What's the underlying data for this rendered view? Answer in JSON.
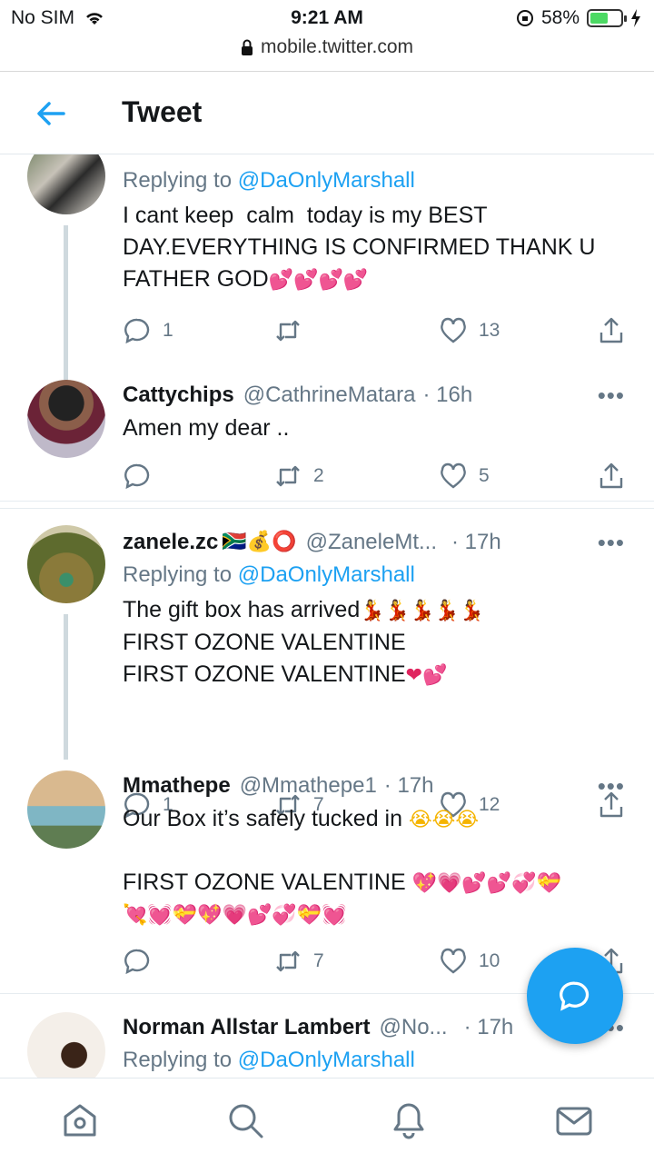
{
  "status_bar": {
    "carrier": "No SIM",
    "time": "9:21 AM",
    "battery": "58%",
    "battery_level": 0.58
  },
  "browser": {
    "url": "mobile.twitter.com"
  },
  "header": {
    "title": "Tweet"
  },
  "tweets": [
    {
      "name": "",
      "handle": "",
      "time": "",
      "replying_label": "Replying to",
      "replying_to": "@DaOnlyMarshall",
      "text": "I cant keep  calm  today is my BEST DAY.EVERYTHING IS CONFIRMED THANK U FATHER GOD",
      "emoji": "💕💕💕💕",
      "replies": "1",
      "retweets": "",
      "likes": "13"
    },
    {
      "name": "Cattychips",
      "handle": "@CathrineMatara",
      "time": "· 16h",
      "text": "Amen my dear ..",
      "replies": "",
      "retweets": "2",
      "likes": "5"
    },
    {
      "name": "zanele.zc",
      "name_emoji": "🇿🇦💰⭕",
      "handle": "@ZaneleMt...",
      "time": "· 17h",
      "replying_label": "Replying to",
      "replying_to": "@DaOnlyMarshall",
      "text_line1": "The gift box has arrived",
      "line1_emoji": "💃💃💃💃💃",
      "text_line2": "FIRST OZONE VALENTINE",
      "text_line3": "FIRST OZONE VALENTINE",
      "line3_emoji": "❤💕",
      "replies": "1",
      "retweets": "7",
      "likes": "12"
    },
    {
      "name": "Mmathepe",
      "handle": "@Mmathepe1",
      "time": "· 17h",
      "text_line1": "Our Box it’s safely tucked in",
      "line1_emoji": "😭😭😭",
      "text_line2": "FIRST OZONE VALENTINE",
      "line2_emoji": "💖💗💕💕💞💝",
      "line3_emoji": "💘💓💝💖💗💕💞💝💓",
      "replies": "",
      "retweets": "7",
      "likes": "10"
    },
    {
      "name": "Norman Allstar Lambert",
      "handle": "@No...",
      "time": "· 17h",
      "replying_label": "Replying to",
      "replying_to": "@DaOnlyMarshall"
    }
  ],
  "icons": {
    "back": "arrow-left-icon",
    "reply": "reply-icon",
    "retweet": "retweet-icon",
    "like": "heart-icon",
    "share": "share-icon",
    "more": "more-icon",
    "fab": "compose-reply-icon",
    "nav": [
      "home-icon",
      "search-icon",
      "notifications-icon",
      "messages-icon"
    ]
  },
  "colors": {
    "accent": "#1da1f2",
    "muted": "#657786",
    "text": "#14171a"
  }
}
